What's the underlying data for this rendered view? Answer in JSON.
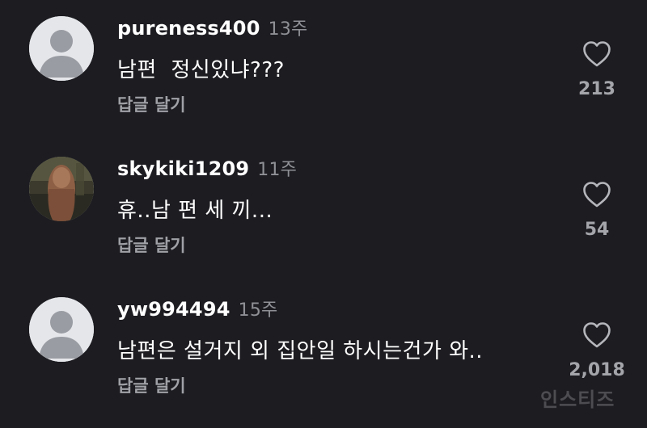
{
  "comments": [
    {
      "username": "pureness400",
      "time": "13주",
      "text": "남편  정신있냐???",
      "reply_label": "답글 달기",
      "likes": "213",
      "avatar": "default-avatar"
    },
    {
      "username": "skykiki1209",
      "time": "11주",
      "text": "휴..남 편 세 끼...",
      "reply_label": "답글 달기",
      "likes": "54",
      "avatar": "photo-avatar"
    },
    {
      "username": "yw994494",
      "time": "15주",
      "text": "남편은 설거지 외 집안일 하시는건가 와..",
      "reply_label": "답글 달기",
      "likes": "2,018",
      "avatar": "default-avatar"
    }
  ],
  "watermark": "인스티즈",
  "icons": {
    "like": "heart-outline-icon"
  },
  "colors": {
    "background": "#1c1c21",
    "secondary_text": "#a0a1a7"
  }
}
